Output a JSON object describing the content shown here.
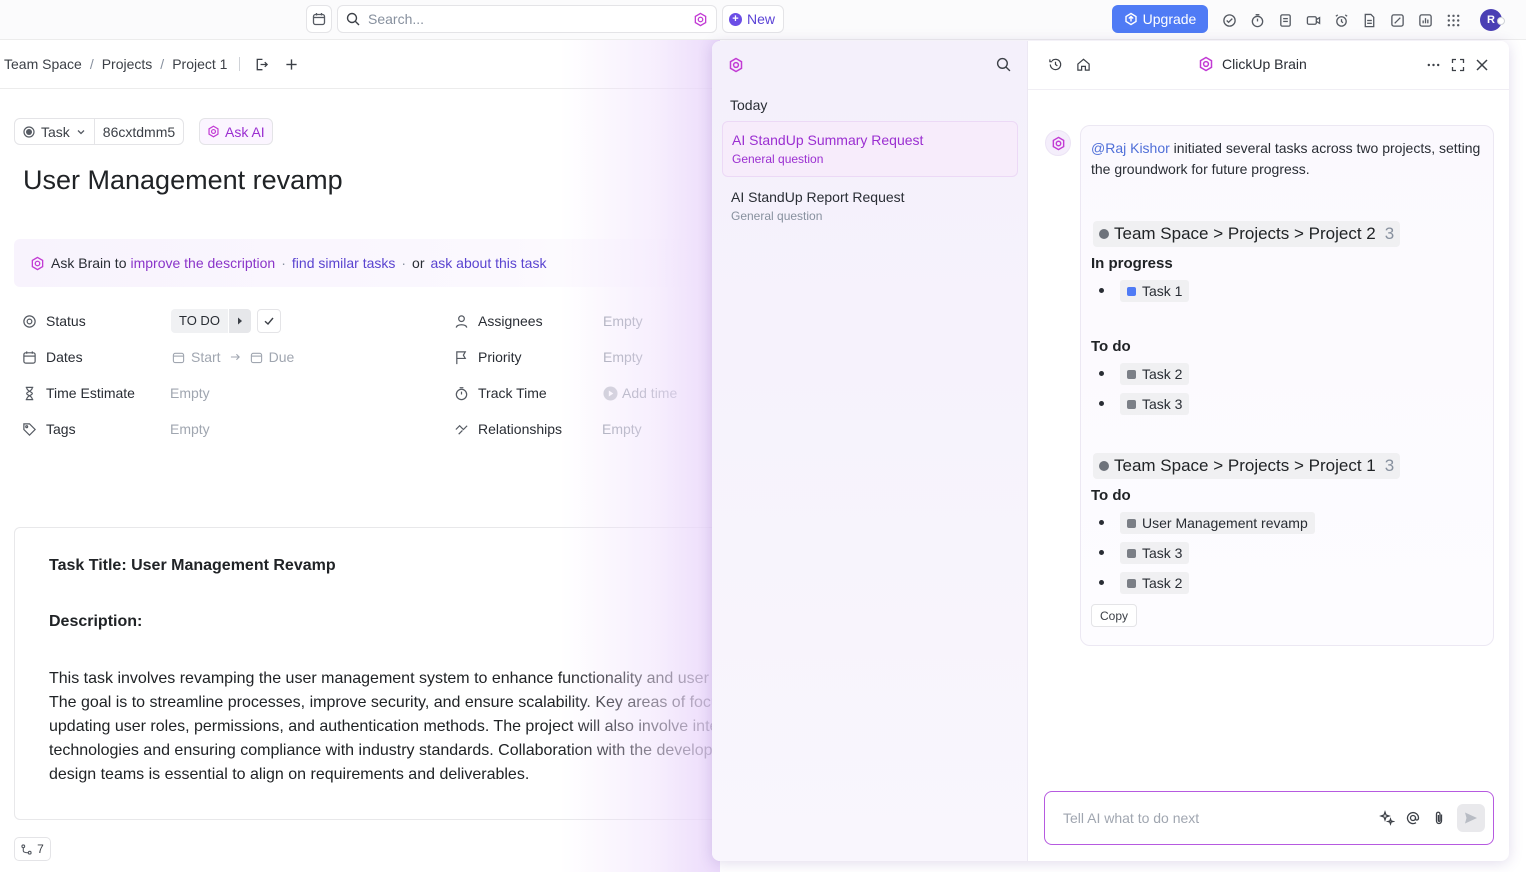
{
  "topbar": {
    "search_placeholder": "Search...",
    "new_label": "New",
    "upgrade_label": "Upgrade",
    "avatar_initial": "R"
  },
  "breadcrumb": [
    "Team Space",
    "Projects",
    "Project 1"
  ],
  "task": {
    "type_label": "Task",
    "id": "86cxtdmm5",
    "ask_ai_label": "Ask AI",
    "title": "User Management revamp"
  },
  "ask_brain": {
    "prefix": "Ask Brain to",
    "link1": "improve the description",
    "link2": "find similar tasks",
    "or": "or",
    "link3": "ask about this task"
  },
  "fields_left": [
    {
      "label": "Status",
      "icon": "status-icon"
    },
    {
      "label": "Dates",
      "icon": "calendar-icon",
      "start": "Start",
      "due": "Due"
    },
    {
      "label": "Time Estimate",
      "icon": "hourglass-icon",
      "value": "Empty"
    },
    {
      "label": "Tags",
      "icon": "tag-icon",
      "value": "Empty"
    }
  ],
  "status_value": "TO DO",
  "fields_right": [
    {
      "label": "Assignees",
      "icon": "user-icon",
      "value": "Empty"
    },
    {
      "label": "Priority",
      "icon": "flag-icon",
      "value": "Empty"
    },
    {
      "label": "Track Time",
      "icon": "timer-icon",
      "value": "Add time"
    },
    {
      "label": "Relationships",
      "icon": "relationship-icon",
      "value": "Empty"
    }
  ],
  "description": {
    "heading1": "Task Title: User Management Revamp",
    "heading2": "Description:",
    "lines": [
      "This task involves revamping the user management system to enhance functionality and user experience.",
      "The goal is to streamline processes, improve security, and ensure scalability. Key areas of focus include",
      "updating user roles, permissions, and authentication methods. The project will also involve integrating new",
      "technologies and ensuring compliance with industry standards. Collaboration with the development and",
      "design teams is essential to align on requirements and deliverables."
    ]
  },
  "subtask_count": "7",
  "brain": {
    "title": "ClickUp Brain",
    "history_heading": "Today",
    "history": [
      {
        "title": "AI StandUp Summary Request",
        "sub": "General question",
        "active": true
      },
      {
        "title": "AI StandUp Report Request",
        "sub": "General question",
        "active": false
      }
    ],
    "message": {
      "mention": "@Raj Kishor",
      "intro_rest": " initiated several tasks across two projects, setting the groundwork for future progress.",
      "groups": [
        {
          "path": "Team Space > Projects > Project 2",
          "count": "3",
          "sections": [
            {
              "name": "In progress",
              "tasks": [
                "Task 1"
              ]
            },
            {
              "name": "To do",
              "tasks": [
                "Task 2",
                "Task 3"
              ]
            }
          ]
        },
        {
          "path": "Team Space > Projects > Project 1",
          "count": "3",
          "sections": [
            {
              "name": "To do",
              "tasks": [
                "User Management revamp",
                "Task 3",
                "Task 2"
              ]
            }
          ]
        }
      ],
      "copy_label": "Copy"
    },
    "input_placeholder": "Tell AI what to do next"
  },
  "colors": {
    "accent": "#9b2fd1",
    "upgrade": "#4f7bf5",
    "in_progress_task": "#4f7bf5"
  }
}
